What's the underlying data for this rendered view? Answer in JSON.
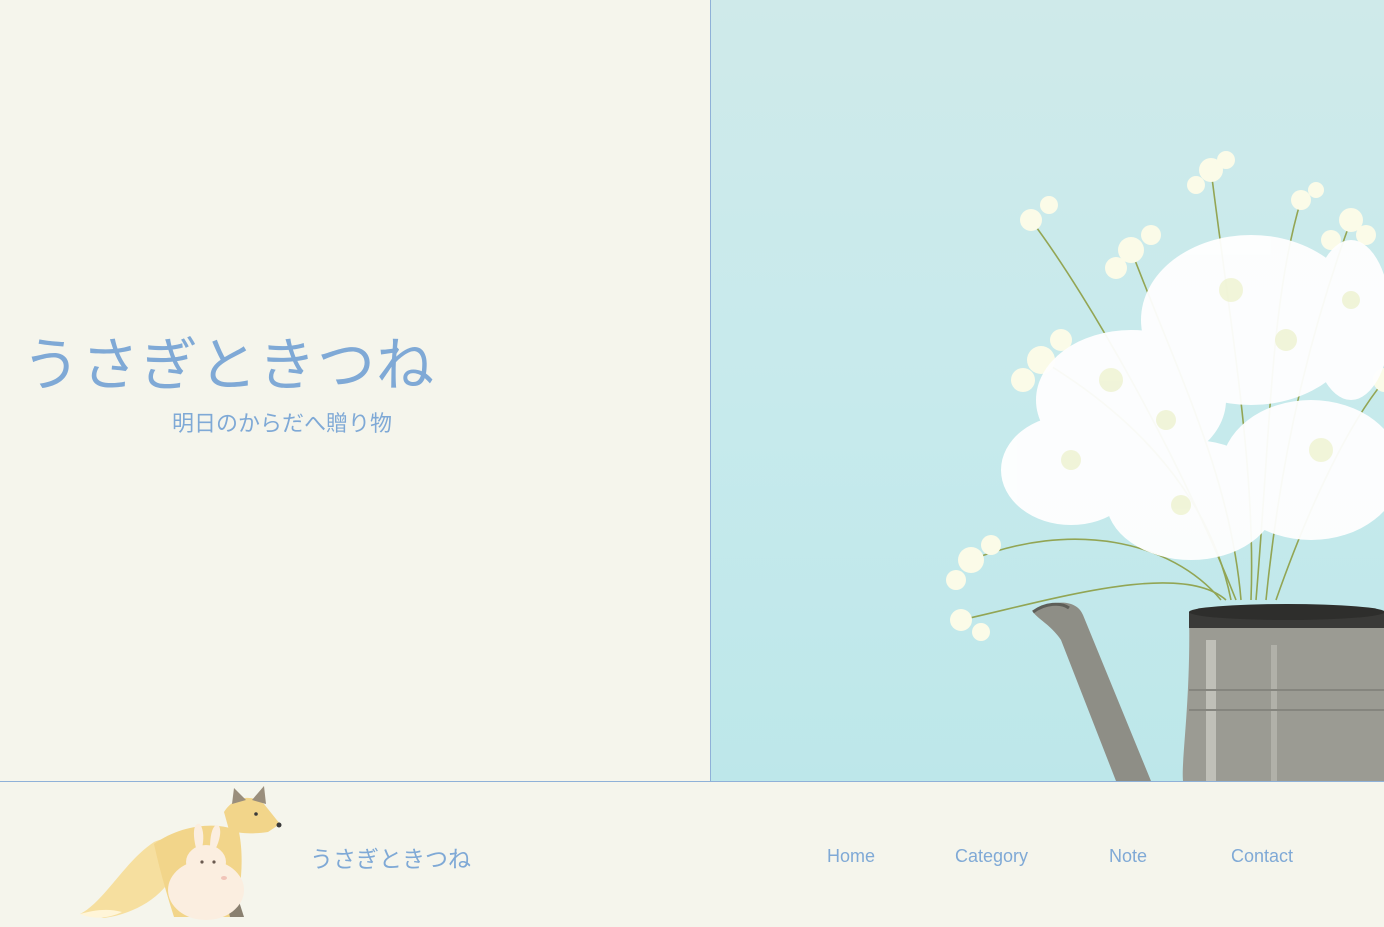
{
  "hero": {
    "title": "うさぎときつね",
    "tagline": "明日のからだへ贈り物",
    "image": "gypsophila-in-enamel-pitcher"
  },
  "footer": {
    "brand": "うさぎときつね",
    "mascot": "fox-and-rabbit-illustration"
  },
  "nav": {
    "items": [
      {
        "label": "Home"
      },
      {
        "label": "Category"
      },
      {
        "label": "Note"
      },
      {
        "label": "Contact"
      }
    ]
  },
  "colors": {
    "accent": "#7fa9d6",
    "background": "#f5f5ec",
    "hero_sky": "#c7eaec"
  }
}
